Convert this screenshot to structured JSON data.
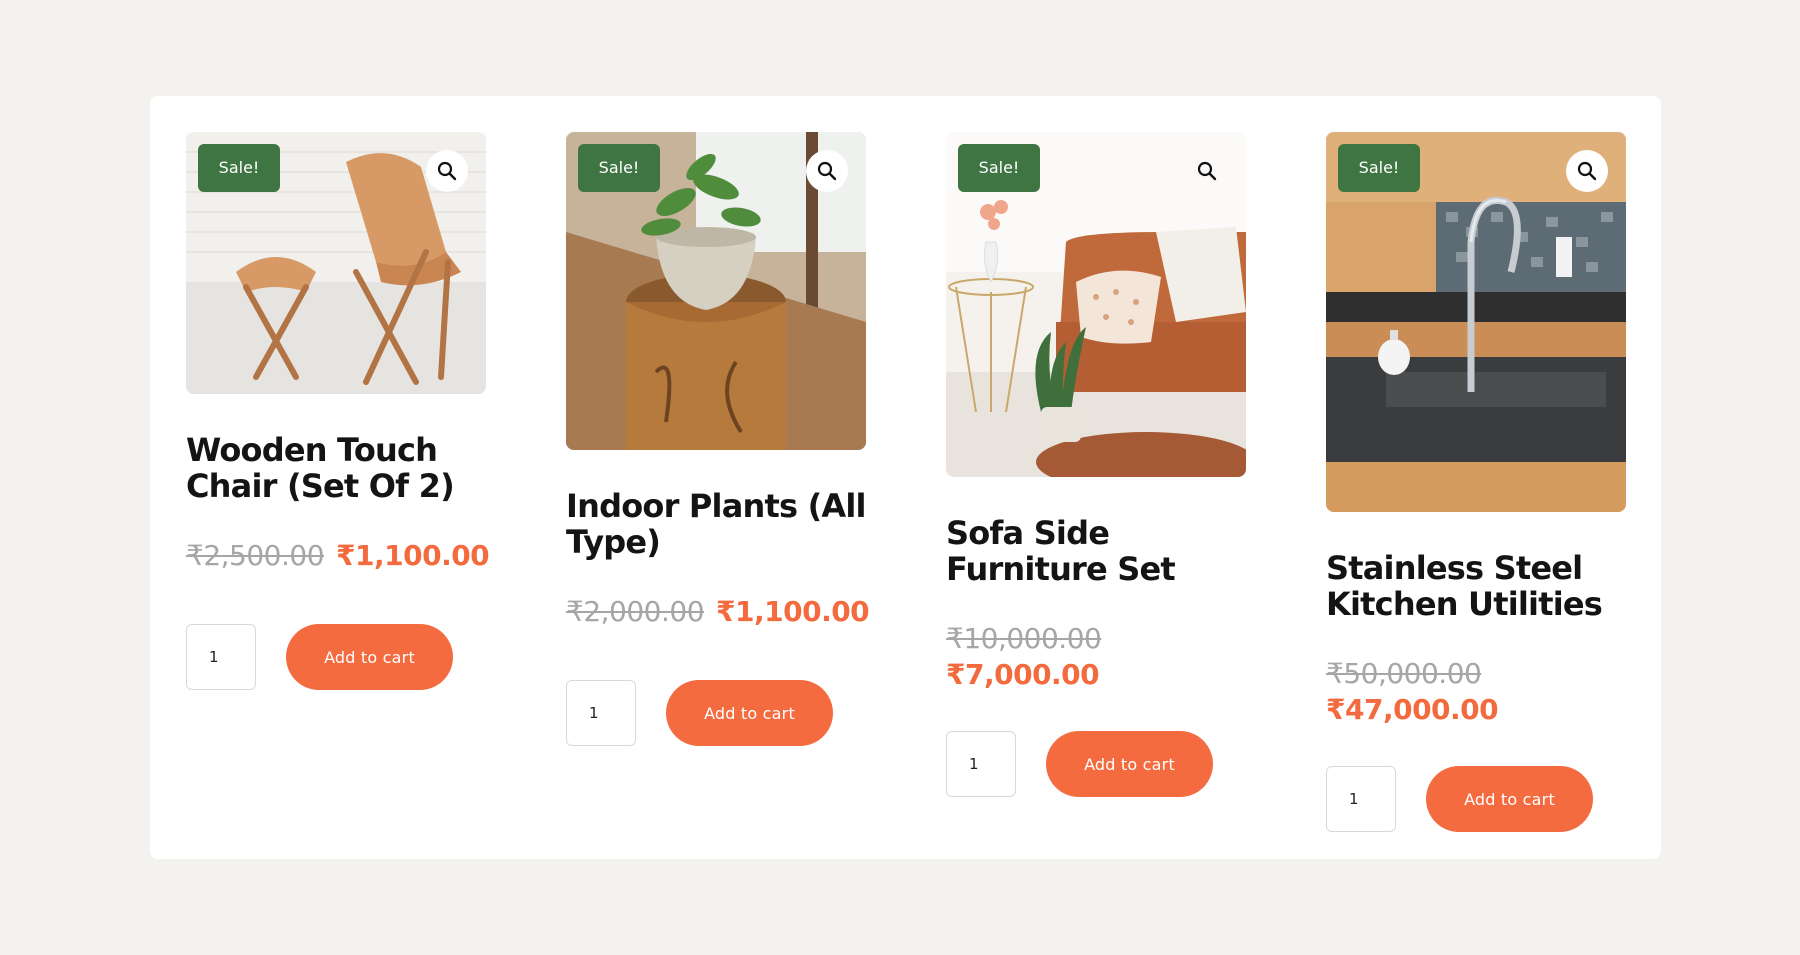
{
  "products": [
    {
      "badge": "Sale!",
      "title": "Wooden Touch Chair (Set Of 2)",
      "old_price": "₹2,500.00",
      "new_price": "₹1,100.00",
      "qty": "1",
      "cart_label": "Add to cart"
    },
    {
      "badge": "Sale!",
      "title": "Indoor Plants (All Type)",
      "old_price": "₹2,000.00",
      "new_price": "₹1,100.00",
      "qty": "1",
      "cart_label": "Add to cart"
    },
    {
      "badge": "Sale!",
      "title": "Sofa Side Furniture Set",
      "old_price": "₹10,000.00",
      "new_price": "₹7,000.00",
      "qty": "1",
      "cart_label": "Add to cart"
    },
    {
      "badge": "Sale!",
      "title": "Stainless Steel Kitchen Utilities",
      "old_price": "₹50,000.00",
      "new_price": "₹47,000.00",
      "qty": "1",
      "cart_label": "Add to cart"
    }
  ],
  "icons": {
    "zoom": "magnifier-icon"
  },
  "colors": {
    "badge": "#3f7443",
    "accent": "#f56b40",
    "price": "#f26a3d",
    "old_price": "#a6a6a6",
    "background": "#f3f2ef"
  }
}
